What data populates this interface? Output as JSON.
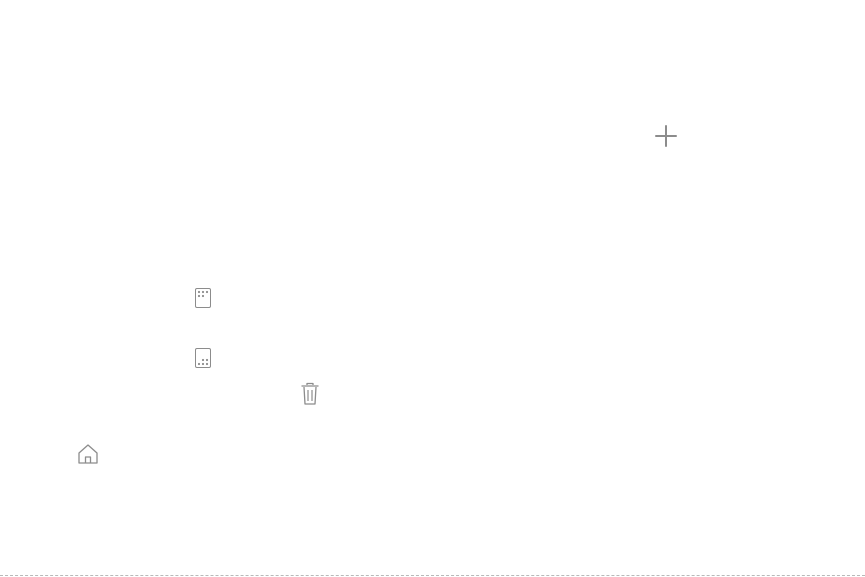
{
  "screen": {
    "background": "#ffffff",
    "icon_color": "#8c8c8c"
  },
  "icons": [
    {
      "name": "add-icon",
      "glyph": "plus"
    },
    {
      "name": "apps-grid-top-icon",
      "glyph": "dots-top-grid"
    },
    {
      "name": "apps-grid-bottom-icon",
      "glyph": "dots-bottom-grid"
    },
    {
      "name": "trash-icon",
      "glyph": "trash-can"
    },
    {
      "name": "home-icon",
      "glyph": "house-outline"
    }
  ]
}
